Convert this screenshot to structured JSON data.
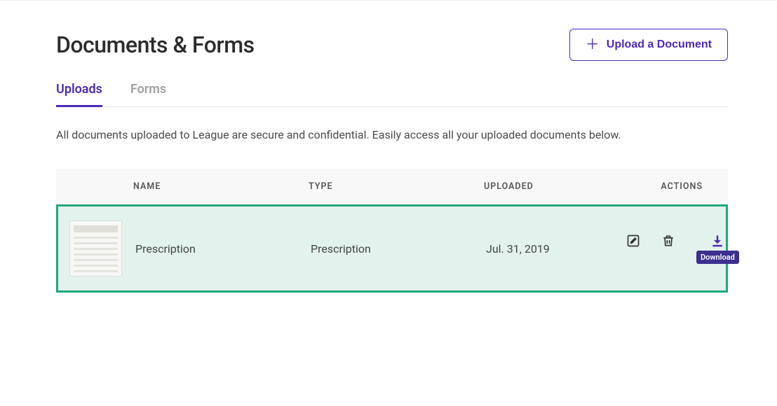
{
  "header": {
    "title": "Documents & Forms",
    "upload_button": "Upload a Document"
  },
  "tabs": {
    "uploads": "Uploads",
    "forms": "Forms"
  },
  "description": "All documents uploaded to League are secure and confidential. Easily access all your uploaded documents below.",
  "table": {
    "columns": {
      "name": "NAME",
      "type": "TYPE",
      "uploaded": "UPLOADED",
      "actions": "ACTIONS"
    },
    "rows": [
      {
        "name": "Prescription",
        "type": "Prescription",
        "uploaded": "Jul. 31, 2019"
      }
    ]
  },
  "tooltip": {
    "download": "Download"
  }
}
